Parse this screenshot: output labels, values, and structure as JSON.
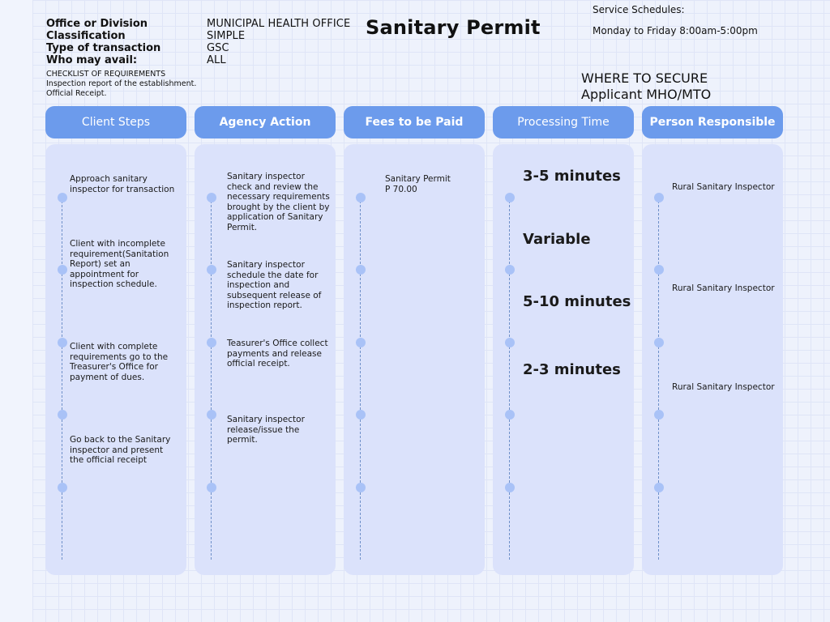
{
  "info": {
    "office_label": "Office or Division",
    "office_value": "MUNICIPAL HEALTH OFFICE",
    "classification_label": "Classification",
    "classification_value": "SIMPLE",
    "transaction_label": "Type of transaction",
    "transaction_value": "GSC",
    "avail_label": "Who may avail:",
    "avail_value": "ALL"
  },
  "checklist": {
    "heading": "CHECKLIST OF REQUIREMENTS",
    "items": [
      "Inspection report of the establishment.",
      "Official Receipt."
    ]
  },
  "title": "Sanitary Permit",
  "schedule": {
    "label": "Service Schedules:",
    "hours": "Monday to Friday 8:00am-5:00pm"
  },
  "secure": {
    "heading": "WHERE TO SECURE",
    "value": "Applicant MHO/MTO"
  },
  "columns": [
    "Client Steps",
    "Agency Action",
    "Fees to be Paid",
    "Processing Time",
    "Person Responsible"
  ],
  "client_steps": [
    "Approach sanitary inspector for transaction",
    "Client with incomplete requirement(Sanitation Report) set an appointment for inspection schedule.",
    "Client with complete requirements go to the Treasurer's Office for payment of dues.",
    "Go back to the Sanitary inspector and present the official receipt"
  ],
  "agency_actions": [
    "Sanitary inspector check and review the necessary requirements brought by the client by application of Sanitary Permit.",
    "Sanitary inspector schedule the date for inspection and subsequent release of inspection report.",
    "Teasurer's Office collect payments and release official receipt.",
    "Sanitary inspector release/issue the permit."
  ],
  "fees": {
    "name": "Sanitary Permit",
    "amount": "P 70.00"
  },
  "processing_times": [
    "3-5 minutes",
    "Variable",
    "5-10 minutes",
    "2-3 minutes"
  ],
  "persons": [
    "Rural Sanitary Inspector",
    "Rural Sanitary Inspector",
    "Rural Sanitary Inspector"
  ],
  "colors": {
    "header": "#6c9bec",
    "column_body": "#dbe2fb",
    "dot": "#a9c2f7"
  }
}
